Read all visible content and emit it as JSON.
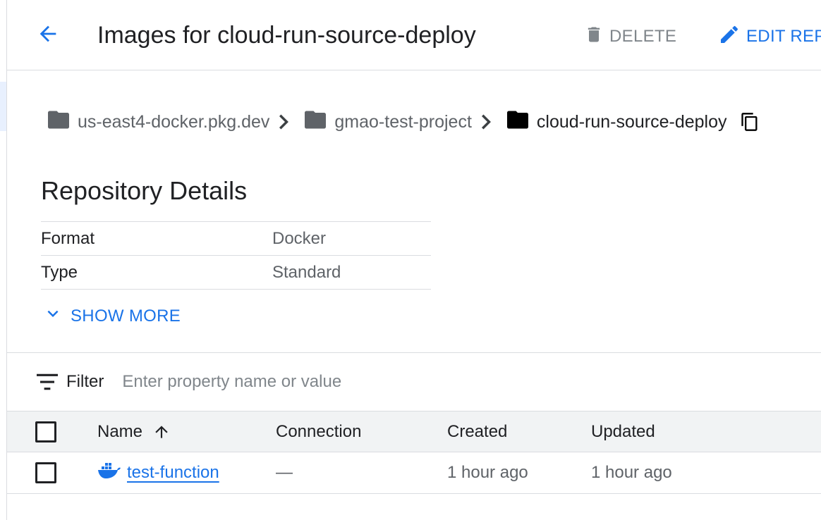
{
  "header": {
    "title": "Images for cloud-run-source-deploy",
    "delete_label": "DELETE",
    "edit_label": "EDIT REP"
  },
  "breadcrumb": [
    {
      "label": "us-east4-docker.pkg.dev"
    },
    {
      "label": "gmao-test-project"
    },
    {
      "label": "cloud-run-source-deploy"
    }
  ],
  "details": {
    "title": "Repository Details",
    "rows": [
      {
        "key": "Format",
        "value": "Docker"
      },
      {
        "key": "Type",
        "value": "Standard"
      }
    ],
    "show_more_label": "SHOW MORE"
  },
  "filter": {
    "label": "Filter",
    "placeholder": "Enter property name or value"
  },
  "table": {
    "columns": {
      "name": "Name",
      "connection": "Connection",
      "created": "Created",
      "updated": "Updated"
    },
    "rows": [
      {
        "name": "test-function",
        "connection": "—",
        "created": "1 hour ago",
        "updated": "1 hour ago"
      }
    ]
  },
  "icons": {
    "back": "arrow-back-icon",
    "delete": "trash-icon",
    "edit": "pencil-icon",
    "folder": "folder-icon",
    "chevron": "chevron-right-icon",
    "copy": "copy-icon",
    "expand": "chevron-down-icon",
    "filter": "filter-icon",
    "sort": "arrow-up-icon",
    "docker": "docker-icon"
  },
  "colors": {
    "accent": "#1a73e8",
    "muted": "#5f6368",
    "border": "#dadce0",
    "header_bg": "#f1f3f4"
  }
}
